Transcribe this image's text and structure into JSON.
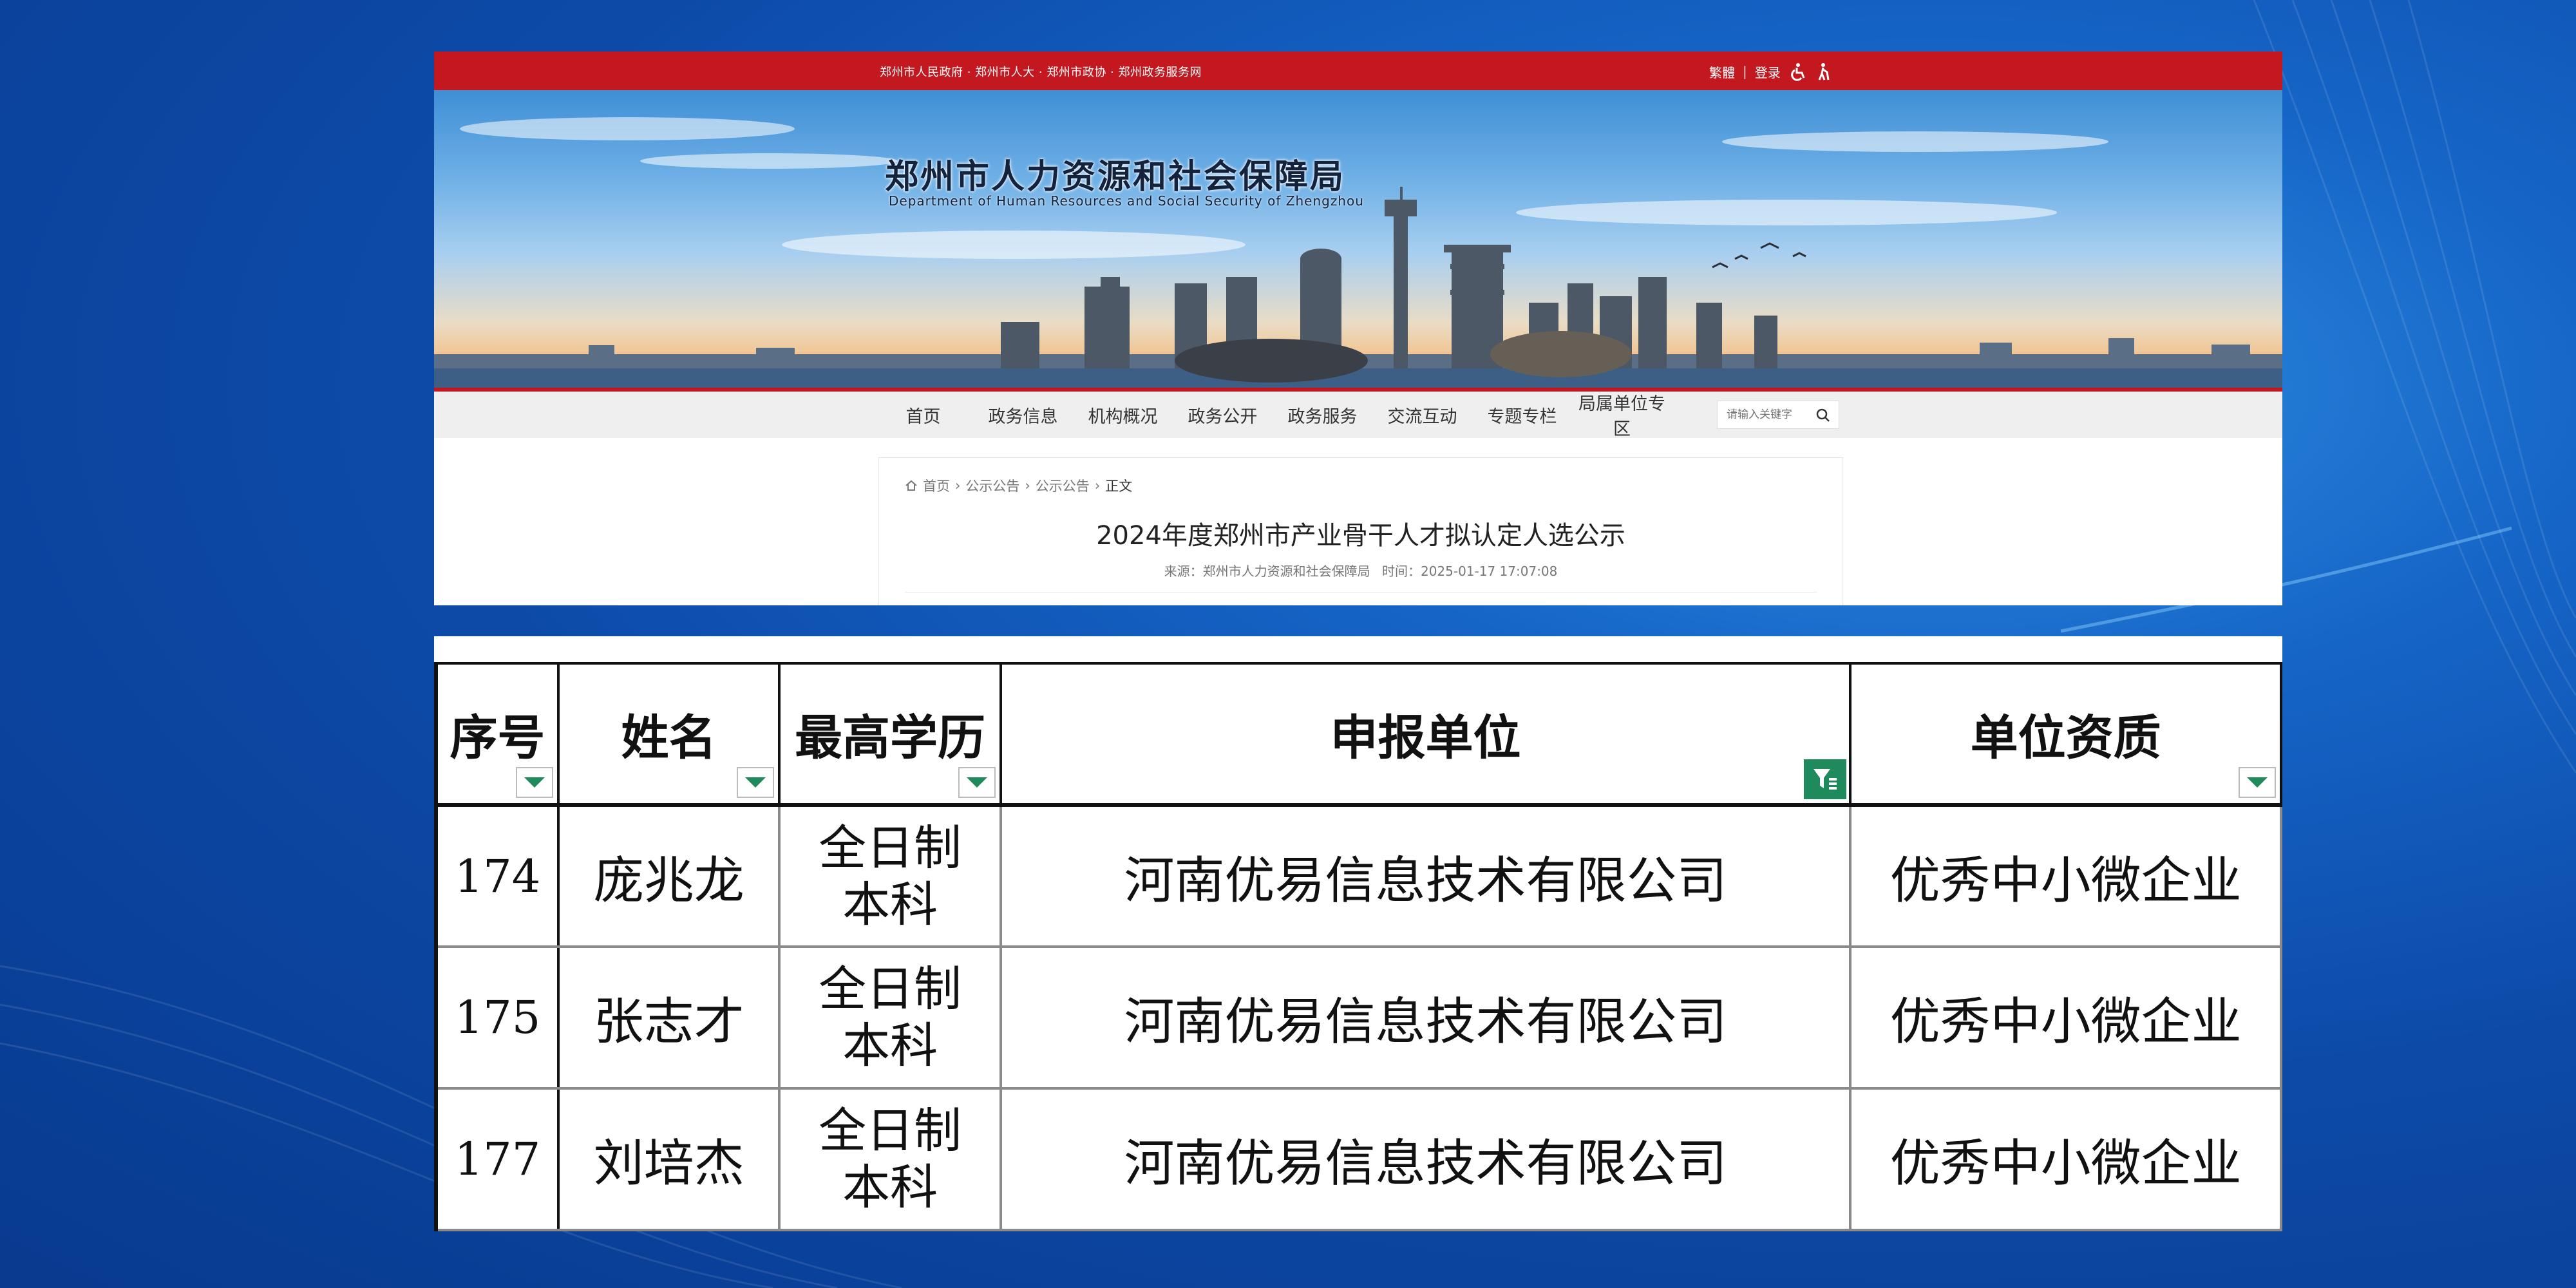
{
  "colors": {
    "accent_red": "#c3181f",
    "filter_green": "#1f8a5c"
  },
  "topbar": {
    "links": "郑州市人民政府 · 郑州市人大 · 郑州市政协 · 郑州政务服务网",
    "traditional": "繁體",
    "divider": "|",
    "login": "登录",
    "icons": [
      "wheelchair-icon",
      "elder-care-icon"
    ]
  },
  "banner": {
    "title": "郑州市人力资源和社会保障局",
    "subtitle": "Department of Human Resources and Social Security of Zhengzhou"
  },
  "nav": {
    "items": [
      "首页",
      "政务信息",
      "机构概况",
      "政务公开",
      "政务服务",
      "交流互动",
      "专题专栏",
      "局属单位专区"
    ],
    "search_placeholder": "请输入关键字"
  },
  "breadcrumb": [
    "首页",
    "公示公告",
    "公示公告",
    "正文"
  ],
  "article": {
    "title": "2024年度郑州市产业骨干人才拟认定人选公示",
    "source": "来源：郑州市人力资源和社会保障局",
    "time": "时间：2025-01-17 17:07:08"
  },
  "table": {
    "headers": [
      "序号",
      "姓名",
      "最高学历",
      "申报单位",
      "单位资质"
    ],
    "rows": [
      {
        "seq": "174",
        "name": "庞兆龙",
        "edu1": "全日制",
        "edu2": "本科",
        "unit": "河南优易信息技术有限公司",
        "qual": "优秀中小微企业"
      },
      {
        "seq": "175",
        "name": "张志才",
        "edu1": "全日制",
        "edu2": "本科",
        "unit": "河南优易信息技术有限公司",
        "qual": "优秀中小微企业"
      },
      {
        "seq": "177",
        "name": "刘培杰",
        "edu1": "全日制",
        "edu2": "本科",
        "unit": "河南优易信息技术有限公司",
        "qual": "优秀中小微企业"
      }
    ]
  }
}
